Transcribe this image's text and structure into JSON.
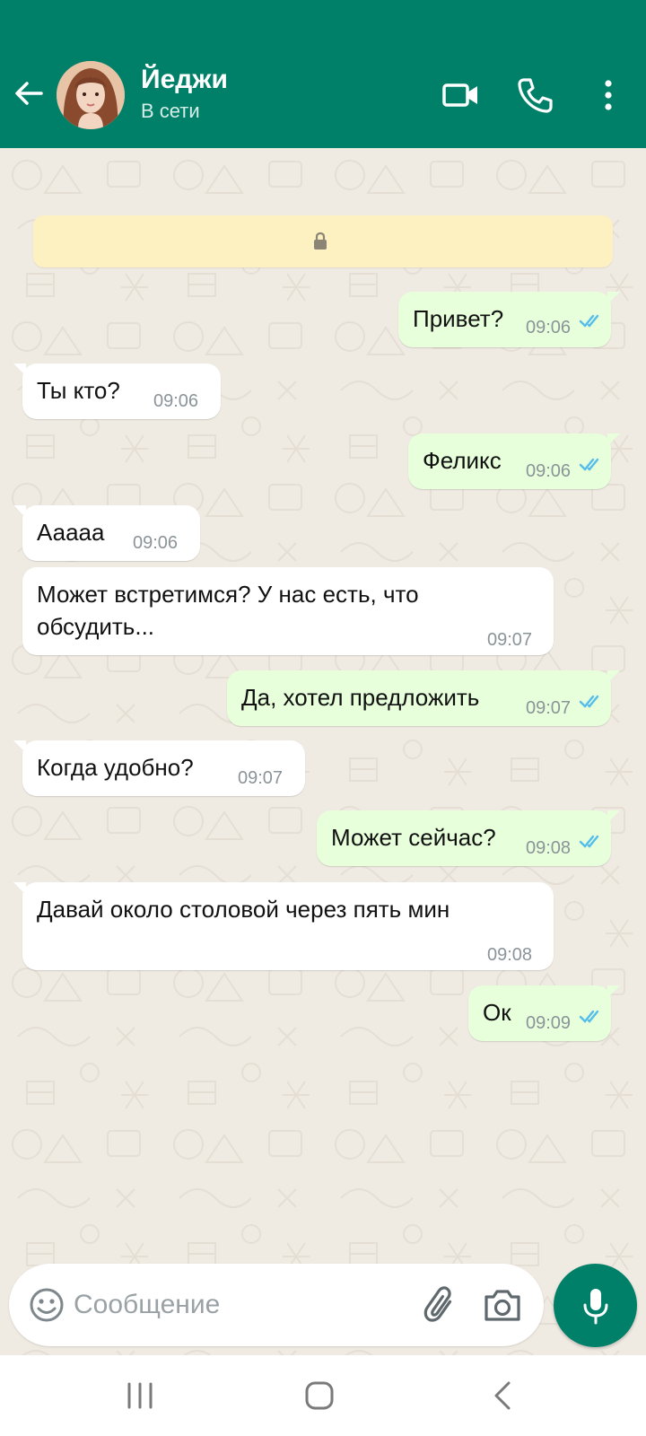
{
  "header": {
    "contact_name": "Йеджи",
    "status": "В сети",
    "background_color": "#008069"
  },
  "messages": [
    {
      "direction": "out",
      "text": "Привет?",
      "time": "09:06",
      "read": true
    },
    {
      "direction": "in",
      "text": "Ты кто?",
      "time": "09:06"
    },
    {
      "direction": "out",
      "text": "Феликс",
      "time": "09:06",
      "read": true
    },
    {
      "direction": "in",
      "text": "Ааааа",
      "time": "09:06"
    },
    {
      "direction": "in",
      "text_line1": "Может встретимся? У нас есть, что",
      "text_line2": "обсудить...",
      "time": "09:07"
    },
    {
      "direction": "out",
      "text": "Да, хотел предложить",
      "time": "09:07",
      "read": true
    },
    {
      "direction": "in",
      "text": "Когда удобно?",
      "time": "09:07"
    },
    {
      "direction": "out",
      "text": "Может сейчас?",
      "time": "09:08",
      "read": true
    },
    {
      "direction": "in",
      "text": "Давай около столовой через пять мин",
      "time": "09:08"
    },
    {
      "direction": "out",
      "text": "Ок",
      "time": "09:09",
      "read": true
    }
  ],
  "input": {
    "placeholder": "Сообщение"
  },
  "colors": {
    "incoming_bubble": "#ffffff",
    "outgoing_bubble": "#e7ffdb",
    "read_ticks": "#53bdeb",
    "wallpaper": "#efeae2",
    "encryption_banner": "#fdf0c1"
  },
  "icons": {
    "back": "arrow-left-icon",
    "video": "video-camera-icon",
    "call": "phone-icon",
    "menu": "more-vertical-icon",
    "lock": "lock-icon",
    "emoji": "emoji-icon",
    "attach": "paperclip-icon",
    "camera": "camera-icon",
    "mic": "microphone-icon"
  }
}
